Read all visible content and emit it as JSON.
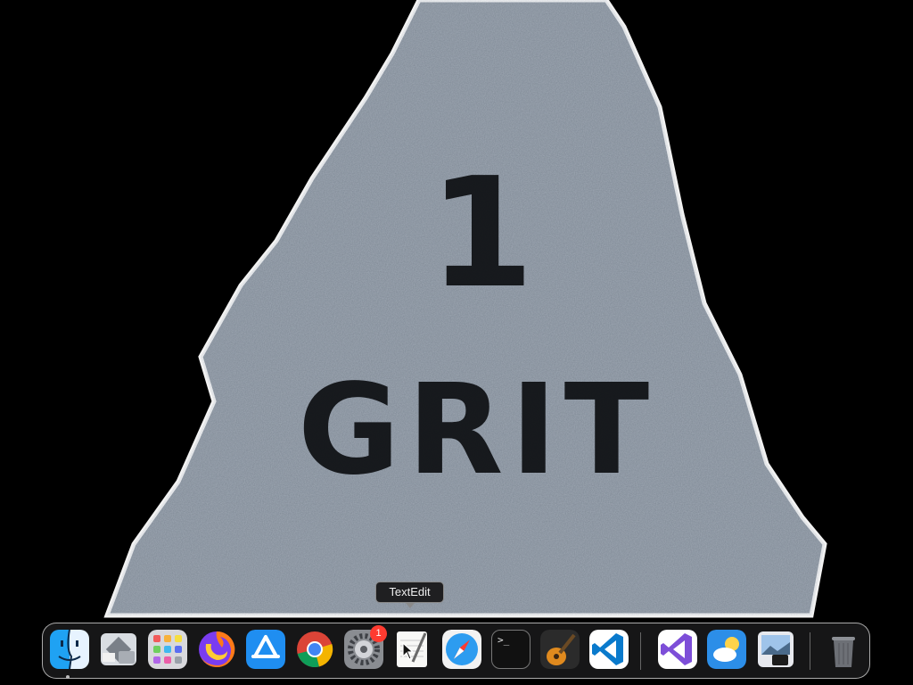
{
  "wallpaper": {
    "rock_text_line1": "1",
    "rock_text_line2": "GRIT"
  },
  "dock": {
    "apps": [
      {
        "name": "Finder",
        "icon": "finder-icon",
        "running": true
      },
      {
        "name": "Boot Camp Assistant",
        "icon": "bootcamp-icon"
      },
      {
        "name": "Launchpad",
        "icon": "launchpad-icon"
      },
      {
        "name": "Firefox",
        "icon": "firefox-icon"
      },
      {
        "name": "App Store",
        "icon": "app-store-icon"
      },
      {
        "name": "Google Chrome",
        "icon": "chrome-icon"
      },
      {
        "name": "System Preferences",
        "icon": "gear-icon",
        "badge": "1"
      },
      {
        "name": "TextEdit",
        "icon": "textedit-icon"
      },
      {
        "name": "Safari",
        "icon": "safari-icon"
      },
      {
        "name": "Terminal",
        "icon": "terminal-icon",
        "glyph": ">_"
      },
      {
        "name": "GarageBand",
        "icon": "guitar-icon"
      },
      {
        "name": "Visual Studio Code",
        "icon": "vscode-icon"
      },
      {
        "name": "Visual Studio",
        "icon": "visual-studio-icon"
      },
      {
        "name": "Weather",
        "icon": "weather-icon"
      },
      {
        "name": "Preview",
        "icon": "preview-icon"
      },
      {
        "name": "Trash",
        "icon": "trash-icon"
      }
    ]
  },
  "tooltip": {
    "label": "TextEdit"
  },
  "colors": {
    "accent_blue": "#1f8ef1",
    "badge_red": "#ff3b30",
    "vscode_blue": "#0a7acc"
  }
}
